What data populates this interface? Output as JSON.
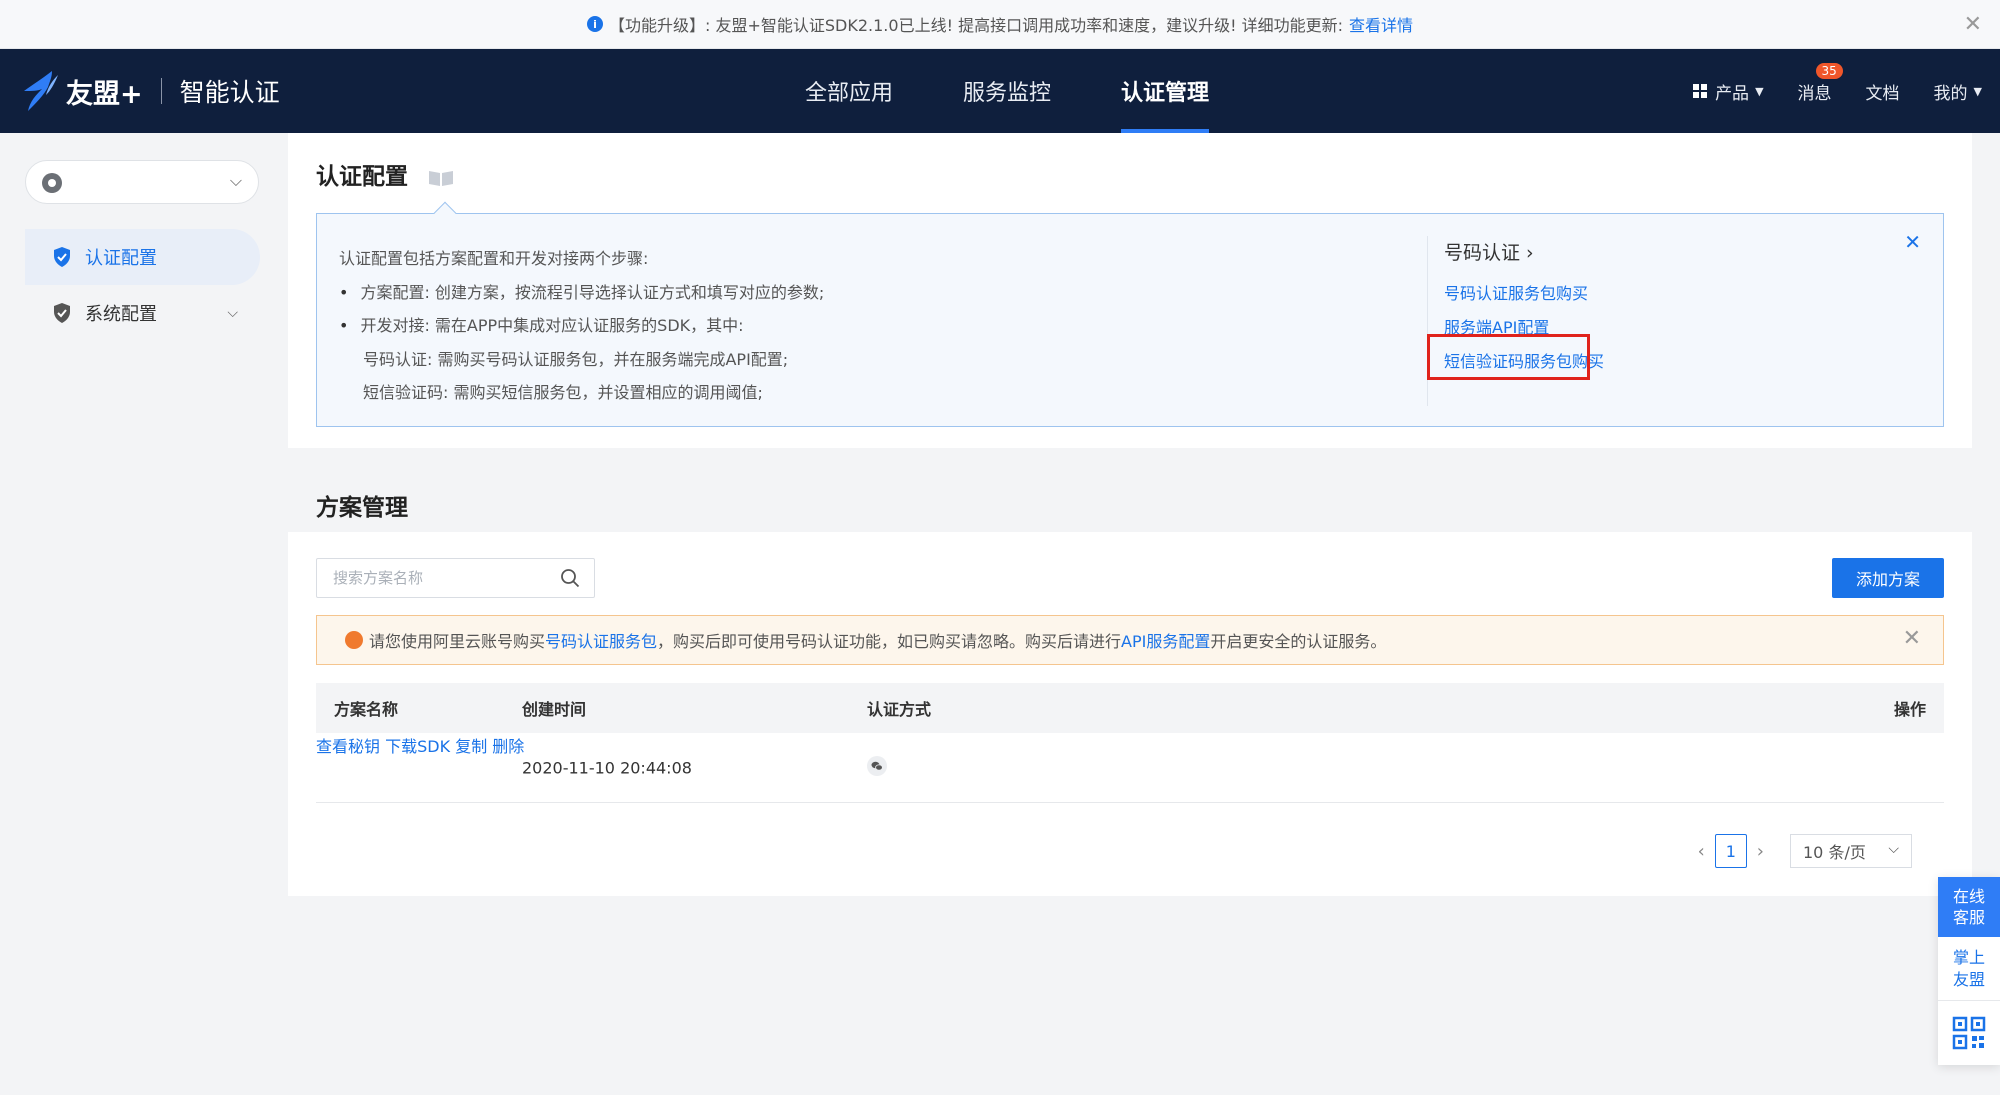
{
  "notice": {
    "text": "【功能升级】: 友盟+智能认证SDK2.1.0已上线! 提高接口调用成功率和速度，建议升级! 详细功能更新:",
    "link": "查看详情"
  },
  "header": {
    "brand_name": "友盟+",
    "product_name": "智能认证",
    "tabs": [
      {
        "label": "全部应用"
      },
      {
        "label": "服务监控"
      },
      {
        "label": "认证管理"
      }
    ],
    "right": {
      "products": "产品",
      "messages": "消息",
      "message_count": "35",
      "docs": "文档",
      "mine": "我的"
    }
  },
  "sidebar": {
    "items": [
      {
        "label": "认证配置"
      },
      {
        "label": "系统配置"
      }
    ]
  },
  "config": {
    "title": "认证配置",
    "lines": [
      "认证配置包括方案配置和开发对接两个步骤:",
      "方案配置: 创建方案，按流程引导选择认证方式和填写对应的参数;",
      "开发对接: 需在APP中集成对应认证服务的SDK，其中:",
      "号码认证: 需购买号码认证服务包，并在服务端完成API配置;",
      "短信验证码: 需购买短信服务包，并设置相应的调用阈值;"
    ],
    "side_title": "号码认证 ›",
    "side_links": [
      "号码认证服务包购买",
      "服务端API配置",
      "短信验证码服务包购买"
    ]
  },
  "plans": {
    "title": "方案管理",
    "search_placeholder": "搜索方案名称",
    "add_button": "添加方案",
    "warn": {
      "pre": "请您使用阿里云账号购买",
      "link1": "号码认证服务包",
      "mid": "，购买后即可使用号码认证功能，如已购买请忽略。购买后请进行",
      "link2": "API服务配置",
      "post": "开启更安全的认证服务。"
    },
    "columns": [
      "方案名称",
      "创建时间",
      "认证方式",
      "操作"
    ],
    "rows": [
      {
        "name": "",
        "created": "2020-11-10 20:44:08",
        "ops": [
          "查看秘钥",
          "下载SDK",
          "复制",
          "删除"
        ]
      }
    ],
    "pagination": {
      "current": "1",
      "page_size": "10 条/页"
    }
  },
  "float": {
    "service": "在线客服",
    "app": "掌上友盟"
  }
}
